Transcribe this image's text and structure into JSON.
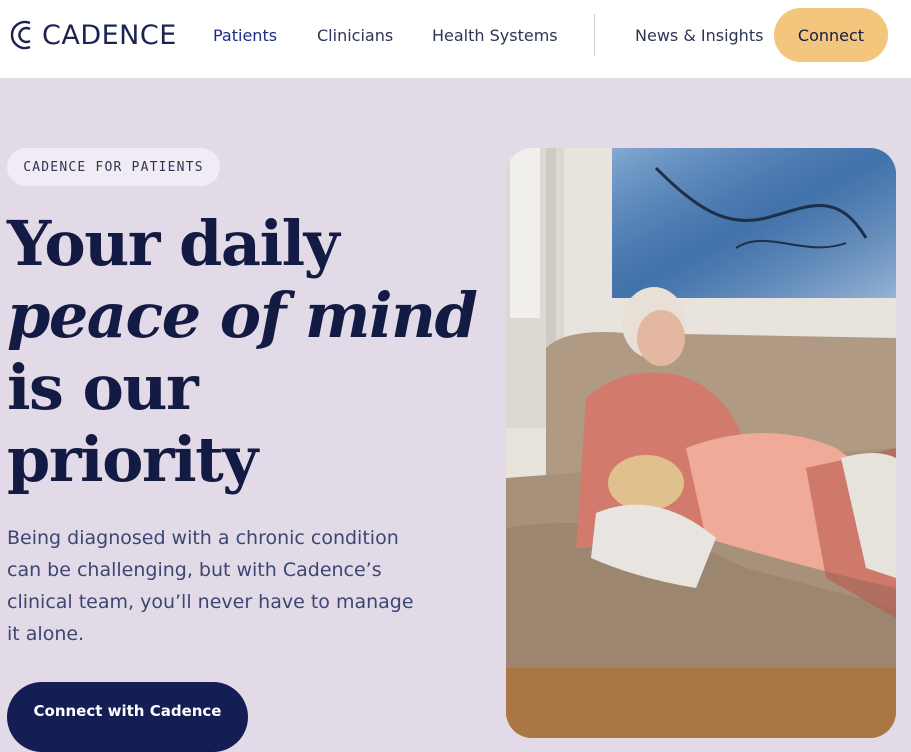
{
  "header": {
    "logo_text": "CADENCE",
    "nav": [
      {
        "label": "Patients",
        "active": true
      },
      {
        "label": "Clinicians"
      },
      {
        "label": "Health Systems"
      },
      {
        "label": "News & Insights"
      }
    ],
    "connect_label": "Connect"
  },
  "hero": {
    "eyebrow": "CADENCE FOR PATIENTS",
    "headline_lines": [
      "Your daily",
      "peace of mind",
      "is our",
      "priority"
    ],
    "description": "Being diagnosed with a chronic condition can be challenging, but with Cadence’s clinical team, you’ll never have to manage it alone.",
    "cta_label": "Connect with Cadence"
  },
  "colors": {
    "background": "#e3dae7",
    "navy": "#131b45",
    "accent": "#f3c57d",
    "active_nav": "#1c2a8c"
  }
}
